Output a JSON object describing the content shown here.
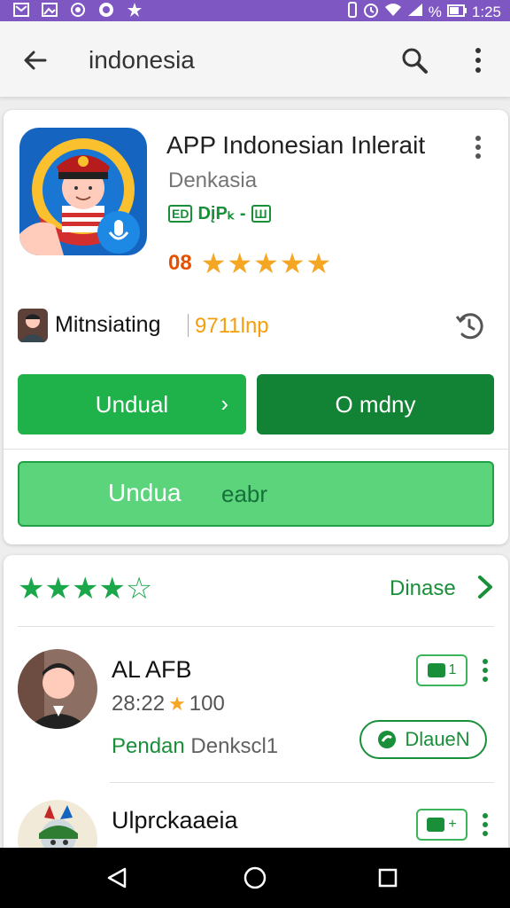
{
  "status_bar": {
    "time": "1:25",
    "battery": "%"
  },
  "search": {
    "query": "indonesia"
  },
  "app": {
    "title": "APP Indonesian Inlerait",
    "developer": "Denkasia",
    "tag_a": "ED",
    "tag_text": "DįPₖ -",
    "tag_b": "Ш",
    "rating_num": "08",
    "stars": "★★★★★",
    "publisher": "Mitnsiating",
    "publisher_count": "9711lnp",
    "install_label": "Undual",
    "install_chevron": "›",
    "open_label": "O mdny",
    "wide_label_left": "Undua",
    "wide_label_right": "eabr"
  },
  "reviews": {
    "stars": "★★★★☆",
    "see_more": "Dinase",
    "items": [
      {
        "name": "AL AFB",
        "time": "28:22",
        "star": "★",
        "score": "100",
        "sub_green": "Pendan",
        "sub_grey": "Denkscl1",
        "badge": "1",
        "pill": "DlaueN"
      },
      {
        "name": "Ulprckaaeia",
        "badge": "+"
      }
    ]
  },
  "colors": {
    "accent": "#1fb14a",
    "accent_dark": "#128234",
    "status_bar": "#7e57c2"
  }
}
